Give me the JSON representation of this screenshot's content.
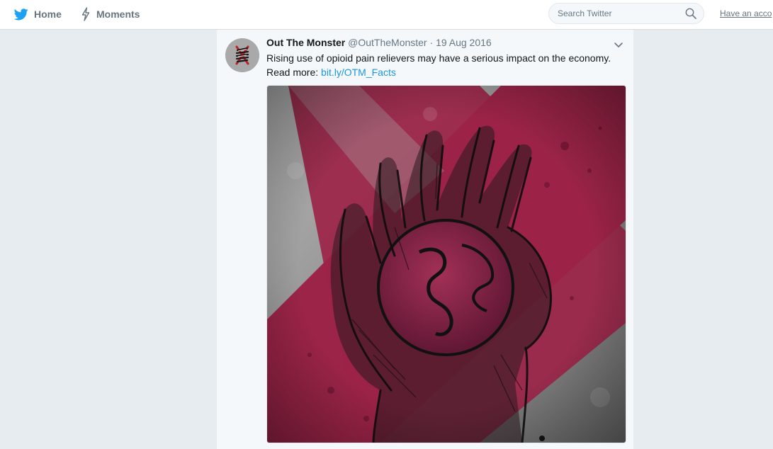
{
  "nav": {
    "home_label": "Home",
    "moments_label": "Moments"
  },
  "search": {
    "placeholder": "Search Twitter"
  },
  "account": {
    "prompt": "Have an acco"
  },
  "tweet": {
    "author_name": "Out The Monster",
    "handle": "@OutTheMonster",
    "separator": "·",
    "date": "19 Aug 2016",
    "text_line1": "Rising use of opioid pain relievers may have a serious impact on the economy.",
    "read_more_label": "Read more:",
    "link_text": "bit.ly/OTM_Facts"
  },
  "colors": {
    "brand_blue": "#1da1f2",
    "link_blue": "#1b95e0",
    "background": "#e6ecf0",
    "image_red": "#9a2447"
  },
  "icons": {
    "home": "twitter-bird-icon",
    "moments": "lightning-icon",
    "search": "search-icon",
    "caret": "chevron-down-icon"
  }
}
